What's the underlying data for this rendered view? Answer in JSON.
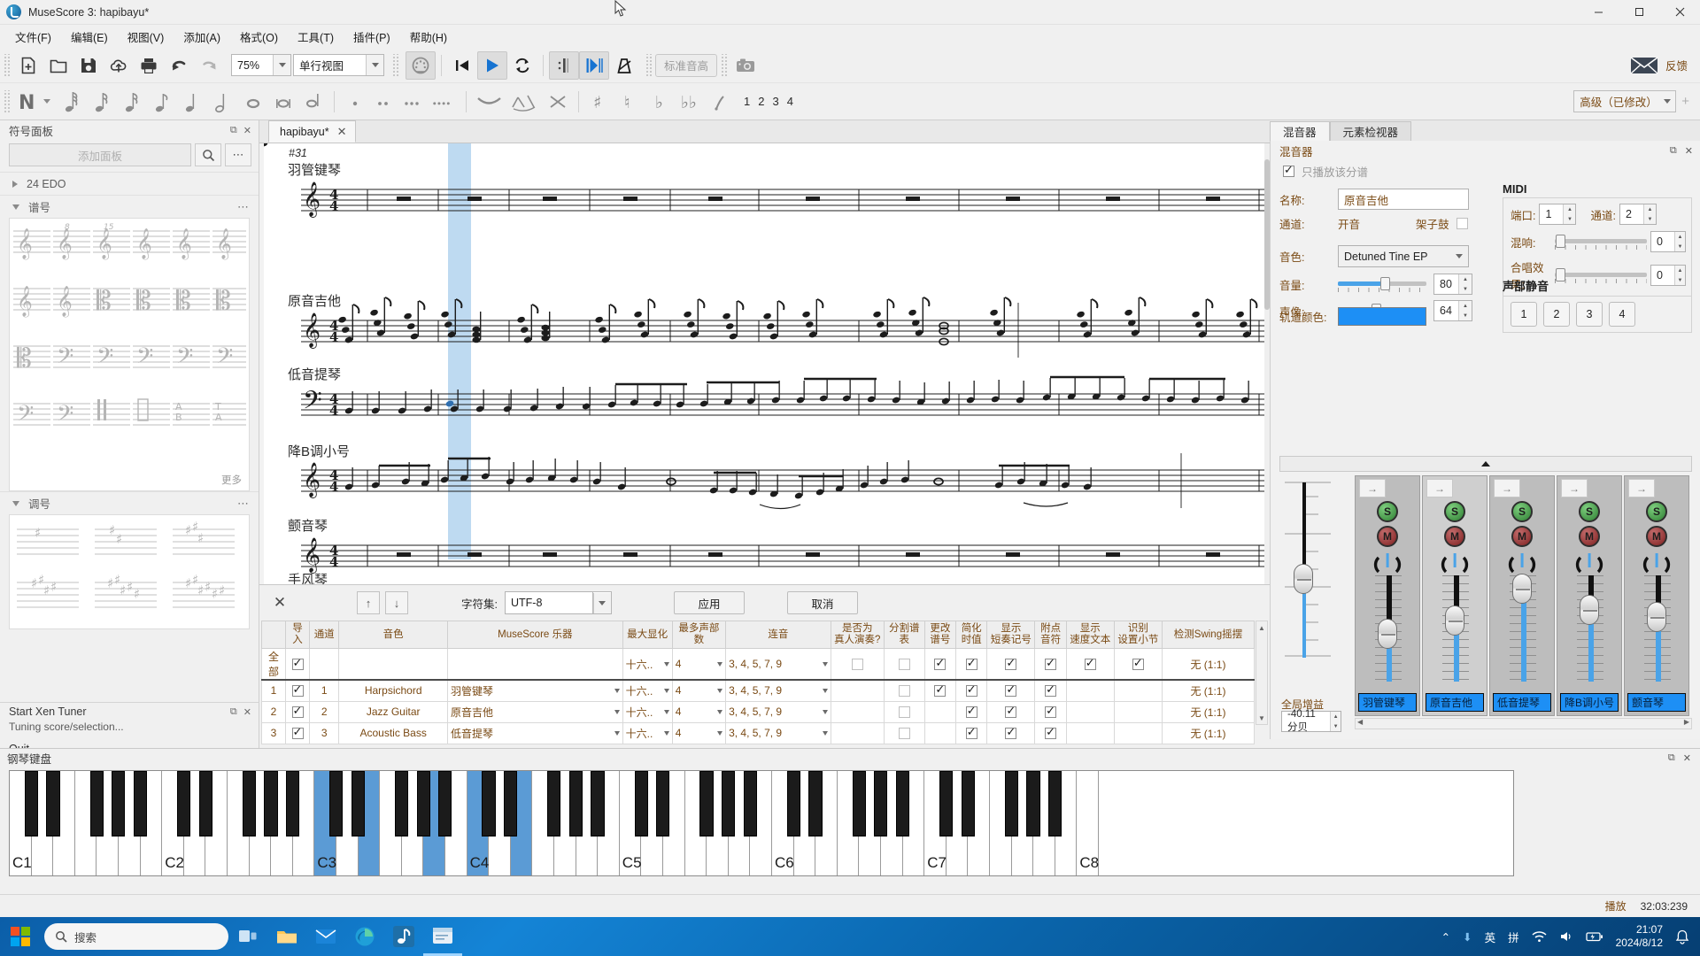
{
  "window": {
    "title": "MuseScore 3: hapibayu*",
    "logo_icon": "musescore-logo-icon",
    "minimize_icon": "minimize-icon",
    "maximize_icon": "maximize-icon",
    "close_icon": "close-icon"
  },
  "menubar": {
    "items": [
      {
        "label": "文件(F)",
        "name": "menu-file"
      },
      {
        "label": "编辑(E)",
        "name": "menu-edit"
      },
      {
        "label": "视图(V)",
        "name": "menu-view"
      },
      {
        "label": "添加(A)",
        "name": "menu-add"
      },
      {
        "label": "格式(O)",
        "name": "menu-format"
      },
      {
        "label": "工具(T)",
        "name": "menu-tools"
      },
      {
        "label": "插件(P)",
        "name": "menu-plugins"
      },
      {
        "label": "帮助(H)",
        "name": "menu-help"
      }
    ]
  },
  "toolbar_main": {
    "new_icon": "new-score-icon",
    "open_icon": "open-folder-icon",
    "save_icon": "save-icon",
    "save_online_icon": "save-online-cloud-icon",
    "print_icon": "print-icon",
    "undo_icon": "undo-icon",
    "redo_icon": "redo-icon",
    "zoom_value": "75%",
    "view_mode": "单行视图",
    "midi_input_icon": "midi-input-icon",
    "rewind_icon": "rewind-to-start-icon",
    "play_icon": "play-icon",
    "loop_icon": "loop-playback-icon",
    "play_repeats_icon": "play-repeats-icon",
    "pan_score_icon": "pan-score-icon",
    "metronome_icon": "metronome-icon",
    "concert_pitch_label": "标准音高",
    "screenshot_icon": "screenshot-camera-icon",
    "feedback_icon": "feedback-envelope-icon",
    "feedback_label": "反馈"
  },
  "toolbar_notes": {
    "note_input_icon": "note-input-icon",
    "durations": [
      "note-64th-icon",
      "note-32nd-icon",
      "note-16th-icon",
      "note-8th-icon",
      "note-quarter-icon",
      "note-half-icon",
      "note-whole-icon",
      "note-breve-icon",
      "note-longa-icon"
    ],
    "dot_icon": "augmentation-dot-icon",
    "tie_icon": "tie-icon",
    "rest_icon": "rest-icon",
    "dots_more_icon": "more-dots-icon",
    "slur_icon": "slur-icon",
    "crescendo_icon": "crescendo-icon",
    "tuplet_icon": "tuplet-icon",
    "double_sharp_icon": "double-sharp-icon",
    "sharp_icon": "sharp-icon",
    "flat_icon": "flat-icon",
    "double_flat_icon": "double-flat-icon",
    "natural_icon": "natural-icon",
    "voices": [
      "1",
      "2",
      "3",
      "4"
    ],
    "workspace": "高级（已修改）",
    "add_workspace_icon": "plus-icon"
  },
  "palette": {
    "title": "符号面板",
    "add_palette_placeholder": "添加面板",
    "search_icon": "search-icon",
    "more_icon": "more-options-icon",
    "float_icon": "undock-icon",
    "close_icon": "close-icon",
    "sections": [
      {
        "label": "24 EDO",
        "expanded": false,
        "name": "palette-section-24edo"
      },
      {
        "label": "谱号",
        "expanded": true,
        "name": "palette-section-clefs"
      },
      {
        "label": "调号",
        "expanded": true,
        "name": "palette-section-keysigs"
      }
    ],
    "more_label": "更多"
  },
  "xen_tuner": {
    "title": "Start Xen Tuner",
    "subtitle": "Tuning score/selection...",
    "quit_label": "Quit",
    "float_icon": "undock-icon",
    "close_icon": "close-icon"
  },
  "score": {
    "tab_label": "hapibayu*",
    "tab_close_icon": "close-icon",
    "measure_number": "#31",
    "staff_names": [
      "羽管键琴",
      "原音吉他",
      "低音提琴",
      "降B调小号",
      "颤音琴",
      "手风琴"
    ],
    "time_signature": "4/4",
    "selection_color": "#a8cdec"
  },
  "midi_import": {
    "close_icon": "close-icon",
    "move_up_icon": "arrow-up-icon",
    "move_down_icon": "arrow-down-icon",
    "charset_label": "字符集:",
    "charset_value": "UTF-8",
    "apply_label": "应用",
    "cancel_label": "取消",
    "columns": [
      "导入",
      "通道",
      "音色",
      "MuseScore 乐器",
      "最大显化",
      "最多声部数",
      "连音",
      "是否为\n真人演奏?",
      "分割谱表",
      "更改\n谱号",
      "简化\n时值",
      "显示\n短奏记号",
      "附点\n音符",
      "显示\n速度文本",
      "识别\n设置小节",
      "检测Swing摇摆"
    ],
    "rows": [
      {
        "index": "全部",
        "import": true,
        "channel": "",
        "sound": "",
        "instrument": "",
        "max_quantize": "十六..",
        "max_voices": "4",
        "tuplets": "3, 4, 5, 7, 9",
        "is_human": false,
        "split_staff": false,
        "change_clef": true,
        "simplify": true,
        "show_staccato": true,
        "dotted": true,
        "show_tempo_text": true,
        "recognize_pickup": true,
        "swing": "无 (1:1)"
      },
      {
        "index": "1",
        "import": true,
        "channel": "1",
        "sound": "Harpsichord",
        "instrument": "羽管键琴",
        "max_quantize": "十六..",
        "max_voices": "4",
        "tuplets": "3, 4, 5, 7, 9",
        "is_human": false,
        "split_staff": false,
        "change_clef": true,
        "simplify": true,
        "show_staccato": true,
        "dotted": true,
        "show_tempo_text": false,
        "recognize_pickup": false,
        "swing": "无 (1:1)"
      },
      {
        "index": "2",
        "import": true,
        "channel": "2",
        "sound": "Jazz Guitar",
        "instrument": "原音吉他",
        "max_quantize": "十六..",
        "max_voices": "4",
        "tuplets": "3, 4, 5, 7, 9",
        "is_human": false,
        "split_staff": false,
        "change_clef": false,
        "simplify": true,
        "show_staccato": true,
        "dotted": true,
        "show_tempo_text": false,
        "recognize_pickup": false,
        "swing": "无 (1:1)"
      },
      {
        "index": "3",
        "import": true,
        "channel": "3",
        "sound": "Acoustic Bass",
        "instrument": "低音提琴",
        "max_quantize": "十六..",
        "max_voices": "4",
        "tuplets": "3, 4, 5, 7, 9",
        "is_human": false,
        "split_staff": false,
        "change_clef": false,
        "simplify": true,
        "show_staccato": true,
        "dotted": true,
        "show_tempo_text": false,
        "recognize_pickup": false,
        "swing": "无 (1:1)"
      }
    ]
  },
  "mixer": {
    "tabs": [
      {
        "label": "混音器",
        "selected": true,
        "name": "tab-mixer"
      },
      {
        "label": "元素检视器",
        "selected": false,
        "name": "tab-inspector"
      }
    ],
    "panel_title": "混音器",
    "float_icon": "undock-icon",
    "close_icon": "close-icon",
    "play_part_only_label": "只播放该分谱",
    "play_part_only_checked": true,
    "name_label": "名称:",
    "name_value": "原音吉他",
    "channel_label": "通道:",
    "channel_value": "开音",
    "drumset_label": "架子鼓",
    "drumset_checked": false,
    "sound_label": "音色:",
    "sound_value": "Detuned Tine EP",
    "volume_label": "音量:",
    "volume_value": "80",
    "pan_label": "声像:",
    "pan_value": "64",
    "track_color_label": "轨道颜色:",
    "track_color": "#1d8ff5",
    "midi_group_title": "MIDI",
    "port_label": "端口:",
    "port_value": "1",
    "midi_channel_label": "通道:",
    "midi_channel_value": "2",
    "reverb_label": "混响:",
    "reverb_value": "0",
    "chorus_label": "合唱效果:",
    "chorus_value": "0",
    "mute_group_title": "声部静音",
    "mute_voices": [
      "1",
      "2",
      "3",
      "4"
    ],
    "collapse_icon": "chevron-up-icon",
    "master_gain_label": "全局增益",
    "master_gain_value": "-40.11分贝",
    "solo_letter": "S",
    "mute_letter": "M",
    "strips": [
      {
        "name": "羽管键琴",
        "solo": false,
        "mute": false,
        "fader": 0.46,
        "lit": false
      },
      {
        "name": "原音吉他",
        "solo": false,
        "mute": false,
        "fader": 0.58,
        "lit": true
      },
      {
        "name": "低音提琴",
        "solo": false,
        "mute": false,
        "fader": 0.88,
        "lit": false
      },
      {
        "name": "降B调小号",
        "solo": false,
        "mute": false,
        "fader": 0.68,
        "lit": false
      },
      {
        "name": "颤音琴",
        "solo": false,
        "mute": false,
        "fader": 0.62,
        "lit": false
      }
    ]
  },
  "piano_keyboard": {
    "title": "钢琴键盘",
    "float_icon": "undock-icon",
    "close_icon": "close-icon",
    "octave_labels": [
      "C1",
      "C2",
      "C3",
      "C4",
      "C5",
      "C6",
      "C7",
      "C8"
    ],
    "highlighted_keys": [
      "C3",
      "E3",
      "A3",
      "C4",
      "E4"
    ],
    "highlight_color": "#5b9bd5"
  },
  "statusbar": {
    "playback_label": "播放",
    "timecode": "32:03:239"
  },
  "taskbar": {
    "start_icon": "windows-start-icon",
    "search_icon": "search-icon",
    "search_placeholder": "搜索",
    "task_view_icon": "task-view-icon",
    "explorer_icon": "file-explorer-icon",
    "mail_icon": "mail-icon",
    "edge_icon": "edge-browser-icon",
    "musescore_icon": "musescore-taskbar-icon",
    "musescore2_icon": "musescore-window-icon",
    "tray_expand_icon": "chevron-up-icon",
    "onedrive_icon": "onedrive-icon",
    "ime_lang": "英",
    "ime_mode": "拼",
    "wifi_icon": "wifi-icon",
    "volume_icon": "speaker-icon",
    "battery_icon": "battery-charging-icon",
    "time": "21:07",
    "date": "2024/8/12",
    "notification_icon": "notification-bell-icon"
  }
}
